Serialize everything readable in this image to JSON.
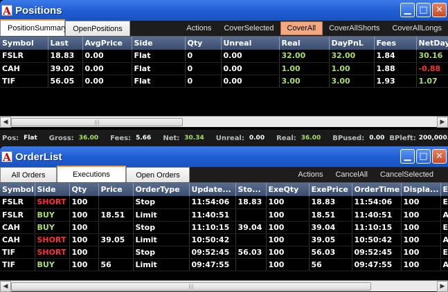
{
  "positions_window": {
    "title": "Positions",
    "tabs": [
      {
        "label": "PositionSummary"
      },
      {
        "label": "OpenPositions"
      }
    ],
    "actions": [
      {
        "label": "Actions"
      },
      {
        "label": "CoverSelected"
      },
      {
        "label": "CoverAll"
      },
      {
        "label": "CoverAllShorts"
      },
      {
        "label": "CoverAllLongs"
      }
    ],
    "columns": [
      "Symbol",
      "Last",
      "AvgPrice",
      "Side",
      "Qty",
      "Unreal",
      "Real",
      "DayPnL",
      "Fees",
      "NetDay"
    ],
    "rows": [
      [
        "FSLR",
        "18.83",
        "0.00",
        "Flat",
        "0",
        "0.00",
        "32.00",
        "32.00",
        "1.84",
        "30.16"
      ],
      [
        "CAH",
        "39.02",
        "0.00",
        "Flat",
        "0",
        "0.00",
        "1.00",
        "1.00",
        "1.88",
        "-0.88"
      ],
      [
        "TIF",
        "56.05",
        "0.00",
        "Flat",
        "0",
        "0.00",
        "3.00",
        "3.00",
        "1.93",
        "1.07"
      ]
    ]
  },
  "status": {
    "pos_label": "Pos:",
    "pos": "Flat",
    "gross_label": "Gross:",
    "gross": "36.00",
    "fees_label": "Fees:",
    "fees": "5.66",
    "net_label": "Net:",
    "net": "30.34",
    "unreal_label": "Unreal:",
    "unreal": "0.00",
    "real_label": "Real:",
    "real": "36.00",
    "bpused_label": "BPused:",
    "bpused": "0.00",
    "bpleft_label": "BPleft:",
    "bpleft": "200,000."
  },
  "orderlist_window": {
    "title": "OrderList",
    "tabs": [
      {
        "label": "All Orders"
      },
      {
        "label": "Executions"
      },
      {
        "label": "Open Orders"
      }
    ],
    "actions": [
      {
        "label": "Actions"
      },
      {
        "label": "CancelAll"
      },
      {
        "label": "CancelSelected"
      }
    ],
    "columns": [
      "Symbol",
      "Side",
      "Qty",
      "Price",
      "OrderType",
      "Update...",
      "Sto...",
      "ExeQty",
      "ExePrice",
      "OrderTime",
      "Displa...",
      "E"
    ],
    "rows": [
      [
        "FSLR",
        "SHORT",
        "100",
        "",
        "Stop",
        "11:54:06",
        "18.83",
        "100",
        "18.83",
        "11:54:06",
        "100",
        "E"
      ],
      [
        "FSLR",
        "BUY",
        "100",
        "18.51",
        "Limit",
        "11:40:51",
        "",
        "100",
        "18.51",
        "11:40:51",
        "100",
        "A"
      ],
      [
        "CAH",
        "BUY",
        "100",
        "",
        "Stop",
        "11:10:15",
        "39.04",
        "100",
        "39.04",
        "11:10:15",
        "100",
        "E"
      ],
      [
        "CAH",
        "SHORT",
        "100",
        "39.05",
        "Limit",
        "10:50:42",
        "",
        "100",
        "39.05",
        "10:50:42",
        "100",
        "A"
      ],
      [
        "TIF",
        "SHORT",
        "100",
        "",
        "Stop",
        "09:52:45",
        "56.03",
        "100",
        "56.03",
        "09:52:45",
        "100",
        "E"
      ],
      [
        "TIF",
        "BUY",
        "100",
        "56",
        "Limit",
        "09:47:55",
        "",
        "100",
        "56",
        "09:47:55",
        "100",
        "A"
      ]
    ]
  },
  "colors": {
    "buy": "#a8e060",
    "short": "#ff3030",
    "positive": "#a8e060",
    "negative": "#ff3030"
  }
}
